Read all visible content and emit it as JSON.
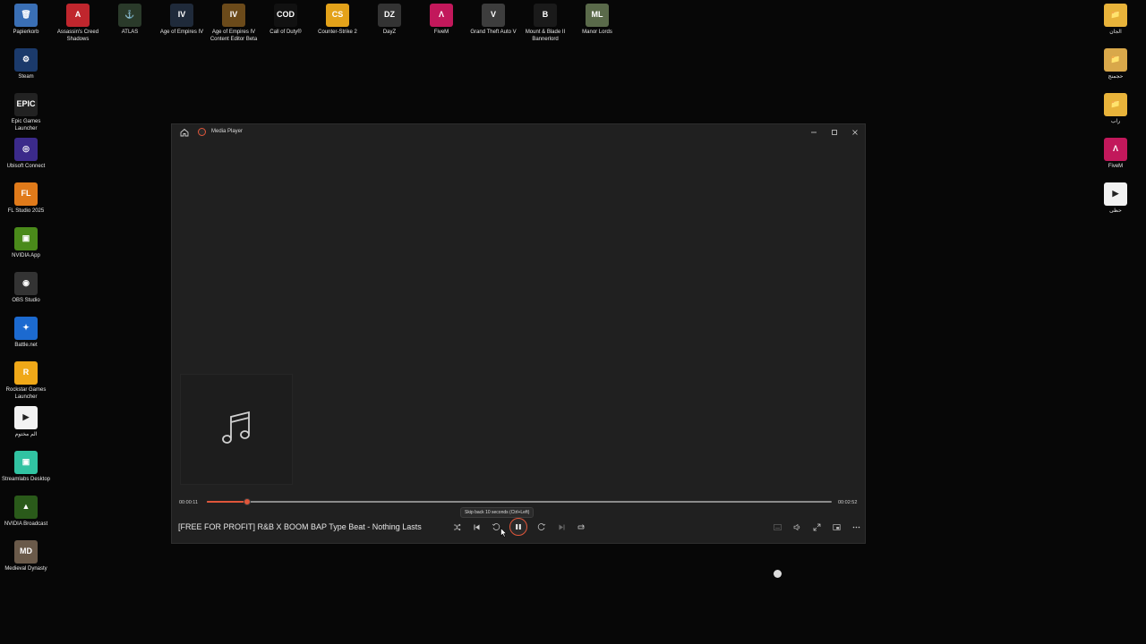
{
  "desktop": {
    "top_row": [
      {
        "label": "Papierkorb",
        "color": "#3a6fb5",
        "glyph": "🗑"
      },
      {
        "label": "Assassin's Creed Shadows",
        "color": "#c0262d",
        "glyph": "A"
      },
      {
        "label": "ATLAS",
        "color": "#2a3a2a",
        "glyph": "⚓"
      },
      {
        "label": "Age of Empires IV",
        "color": "#1f2a3a",
        "glyph": "IV"
      },
      {
        "label": "Age of Empires IV Content Editor Beta",
        "color": "#6b4a1a",
        "glyph": "IV"
      },
      {
        "label": "Call of Duty®",
        "color": "#111111",
        "glyph": "COD"
      },
      {
        "label": "Counter-Strike 2",
        "color": "#e3a21a",
        "glyph": "CS"
      },
      {
        "label": "DayZ",
        "color": "#333333",
        "glyph": "DZ"
      },
      {
        "label": "FiveM",
        "color": "#c2185b",
        "glyph": "Λ"
      },
      {
        "label": "Grand Theft Auto V",
        "color": "#3d3d3d",
        "glyph": "V"
      },
      {
        "label": "Mount & Blade II Bannerlord",
        "color": "#1a1a1a",
        "glyph": "B"
      },
      {
        "label": "Manor Lords",
        "color": "#5a6a4a",
        "glyph": "ML"
      }
    ],
    "left_column": [
      {
        "label": "Steam",
        "color": "#1b3a6b",
        "glyph": "⚙"
      },
      {
        "label": "Epic Games Launcher",
        "color": "#222222",
        "glyph": "EPIC"
      },
      {
        "label": "Ubisoft Connect",
        "color": "#3b2a8a",
        "glyph": "◎"
      },
      {
        "label": "FL Studio 2025",
        "color": "#e07a1a",
        "glyph": "FL"
      },
      {
        "label": "NVIDIA App",
        "color": "#4a8a1a",
        "glyph": "▣"
      },
      {
        "label": "OBS Studio",
        "color": "#333333",
        "glyph": "◉"
      },
      {
        "label": "Battle.net",
        "color": "#1c6ad0",
        "glyph": "✦"
      },
      {
        "label": "Rockstar Games Launcher",
        "color": "#f0a818",
        "glyph": "R"
      },
      {
        "label": "الم مختوم",
        "color": "#f2f2f2",
        "glyph": "▶"
      },
      {
        "label": "Streamlabs Desktop",
        "color": "#31c3a2",
        "glyph": "▣"
      },
      {
        "label": "NVIDIA Broadcast",
        "color": "#2a5a1a",
        "glyph": "▲"
      },
      {
        "label": "Medieval Dynasty",
        "color": "#6a5a4a",
        "glyph": "MD"
      }
    ],
    "right_column": [
      {
        "label": "الجان",
        "color": "#e8b33a",
        "glyph": "📁"
      },
      {
        "label": "حجمنج",
        "color": "#d9a84a",
        "glyph": "📁"
      },
      {
        "label": "راب",
        "color": "#e8b33a",
        "glyph": "📁"
      },
      {
        "label": "FiveM",
        "color": "#c2185b",
        "glyph": "Λ"
      },
      {
        "label": "حظى",
        "color": "#f2f2f2",
        "glyph": "▶"
      }
    ]
  },
  "player": {
    "window_title": "Media Player",
    "elapsed": "00:00:11",
    "total": "00:02:52",
    "progress": 0.064,
    "track_title": "[FREE FOR PROFIT] R&B X BOOM BAP Type Beat - Nothing Lasts",
    "tooltip": "Skip back 10 seconds (Ctrl+Left)",
    "accent": "#e0563a"
  }
}
